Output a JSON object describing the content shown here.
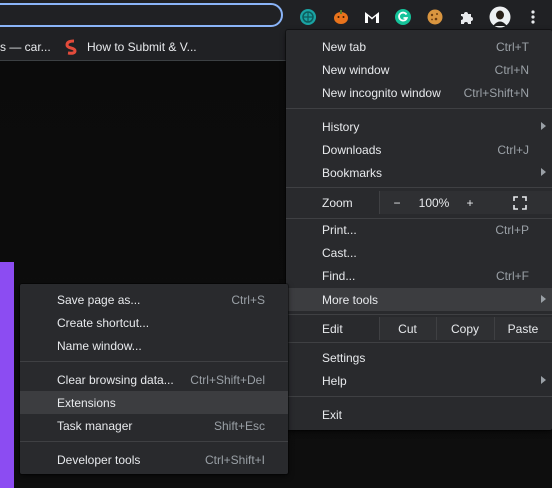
{
  "bookmarks": {
    "item1": "s — car...",
    "item2": "How to Submit & V..."
  },
  "menu": {
    "new_tab": {
      "label": "New tab",
      "shortcut": "Ctrl+T"
    },
    "new_window": {
      "label": "New window",
      "shortcut": "Ctrl+N"
    },
    "new_incognito": {
      "label": "New incognito window",
      "shortcut": "Ctrl+Shift+N"
    },
    "history": {
      "label": "History"
    },
    "downloads": {
      "label": "Downloads",
      "shortcut": "Ctrl+J"
    },
    "bookmarks": {
      "label": "Bookmarks"
    },
    "zoom": {
      "label": "Zoom",
      "minus": "−",
      "value": "100%",
      "plus": "+"
    },
    "print": {
      "label": "Print...",
      "shortcut": "Ctrl+P"
    },
    "cast": {
      "label": "Cast..."
    },
    "find": {
      "label": "Find...",
      "shortcut": "Ctrl+F"
    },
    "more_tools": {
      "label": "More tools"
    },
    "edit": {
      "label": "Edit",
      "cut": "Cut",
      "copy": "Copy",
      "paste": "Paste"
    },
    "settings": {
      "label": "Settings"
    },
    "help": {
      "label": "Help"
    },
    "exit": {
      "label": "Exit"
    }
  },
  "submenu": {
    "save_page": {
      "label": "Save page as...",
      "shortcut": "Ctrl+S"
    },
    "create_shortcut": {
      "label": "Create shortcut..."
    },
    "name_window": {
      "label": "Name window..."
    },
    "clear_browsing": {
      "label": "Clear browsing data...",
      "shortcut": "Ctrl+Shift+Del"
    },
    "extensions": {
      "label": "Extensions"
    },
    "task_manager": {
      "label": "Task manager",
      "shortcut": "Shift+Esc"
    },
    "developer_tools": {
      "label": "Developer tools",
      "shortcut": "Ctrl+Shift+I"
    }
  },
  "extension_icons": [
    "globe-extension-icon",
    "pumpkin-extension-icon",
    "gmail-extension-icon",
    "grammarly-extension-icon",
    "cookie-extension-icon",
    "puzzle-extensions-icon",
    "profile-avatar",
    "kebab-menu-icon"
  ],
  "colors": {
    "accent": "#8ab4f8",
    "menu_bg": "#292a2d",
    "highlight": "#3c3d40",
    "purple": "#8c4cf2"
  }
}
